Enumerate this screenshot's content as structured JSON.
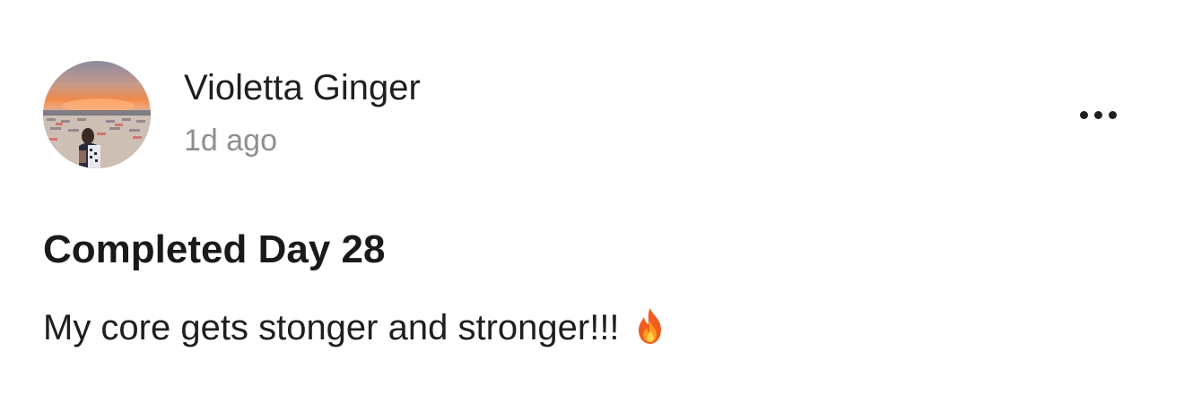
{
  "post": {
    "author": {
      "name": "Violetta Ginger",
      "avatar_icon": "avatar"
    },
    "timestamp": "1d ago",
    "menu_icon": "more-horizontal-icon",
    "title": "Completed Day 28",
    "body": "My core gets stonger and stronger!!!",
    "body_emoji_icon": "fire-icon"
  },
  "colors": {
    "text_primary": "#1f1f1f",
    "text_secondary": "#8e8e8e",
    "background": "#ffffff"
  }
}
